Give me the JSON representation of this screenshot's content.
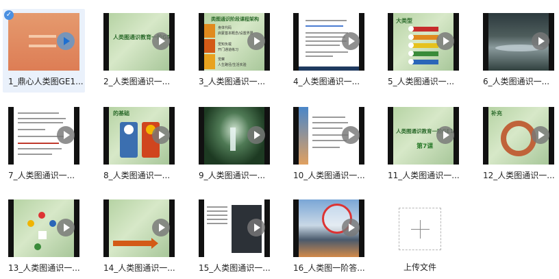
{
  "files": [
    {
      "label": "1_鼎心人类图GE1...",
      "selected": true
    },
    {
      "label": "2_人类图通识一..."
    },
    {
      "label": "3_人类图通识一..."
    },
    {
      "label": "4_人类图通识一..."
    },
    {
      "label": "5_人类图通识一..."
    },
    {
      "label": "6_人类图通识一..."
    },
    {
      "label": "7_人类图通识一..."
    },
    {
      "label": "8_人类图通识一..."
    },
    {
      "label": "9_人类图通识一..."
    },
    {
      "label": "10_人类图通识一..."
    },
    {
      "label": "11_人类图通识一..."
    },
    {
      "label": "12_人类图通识一..."
    },
    {
      "label": "13_人类图通识一..."
    },
    {
      "label": "14_人类图通识一..."
    },
    {
      "label": "15_人类图通识一..."
    },
    {
      "label": "16_人类图一阶答..."
    }
  ],
  "thumb_text": {
    "t2": "人类图通识教育一阶GE1",
    "t3": "类图通识阶段课程架构",
    "t3_items": [
      "身体代码",
      "启蒙基本概念/设置界限",
      "觉知负载",
      "开门通道练习",
      "觉察",
      "人生路径/生活实验"
    ],
    "t5": "大类型",
    "t8": "的基础",
    "t11a": "人类图通识教育一阶GE1",
    "t11b": "第7课",
    "t12": "补充"
  },
  "upload": {
    "label": "上传文件"
  },
  "colors": {
    "selected_bg": "#eaf1fb",
    "accent": "#4a90e2"
  }
}
